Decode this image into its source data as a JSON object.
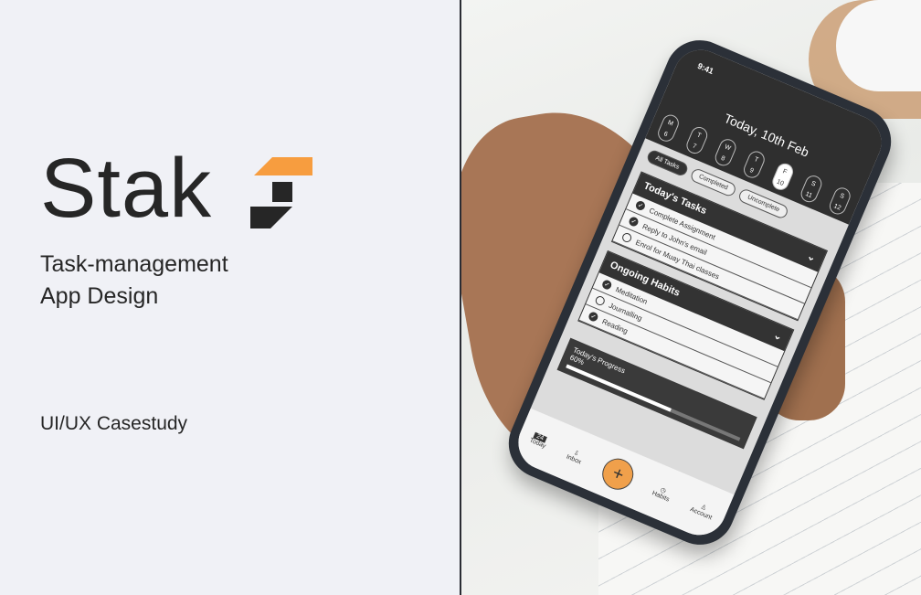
{
  "brand": {
    "name": "Stak",
    "accent": "#f79d3f"
  },
  "subtitle": [
    "Task-management",
    "App Design"
  ],
  "caption": "UI/UX Casestudy",
  "app": {
    "status_time": "9:41",
    "date_title": "Today, 10th Feb",
    "days": [
      {
        "l": "M",
        "n": "6"
      },
      {
        "l": "T",
        "n": "7"
      },
      {
        "l": "W",
        "n": "8"
      },
      {
        "l": "T",
        "n": "9"
      },
      {
        "l": "F",
        "n": "10"
      },
      {
        "l": "S",
        "n": "11"
      },
      {
        "l": "S",
        "n": "12"
      }
    ],
    "filters": [
      "All Tasks",
      "Completed",
      "Uncomplete"
    ],
    "tasks_title": "Today's Tasks",
    "tasks": [
      "Complete Assignment",
      "Reply to John's email",
      "Enrol for Muay Thai classes"
    ],
    "habits_title": "Ongoing Habits",
    "habits": [
      "Meditation",
      "Journalling",
      "Reading"
    ],
    "progress_title": "Today's Progress",
    "progress_percent": "60%",
    "progress_value": 0.6,
    "tabs": {
      "today": "Today",
      "today_date": "24",
      "inbox": "Inbox",
      "add": "+",
      "habits": "Habits",
      "account": "Account"
    }
  }
}
